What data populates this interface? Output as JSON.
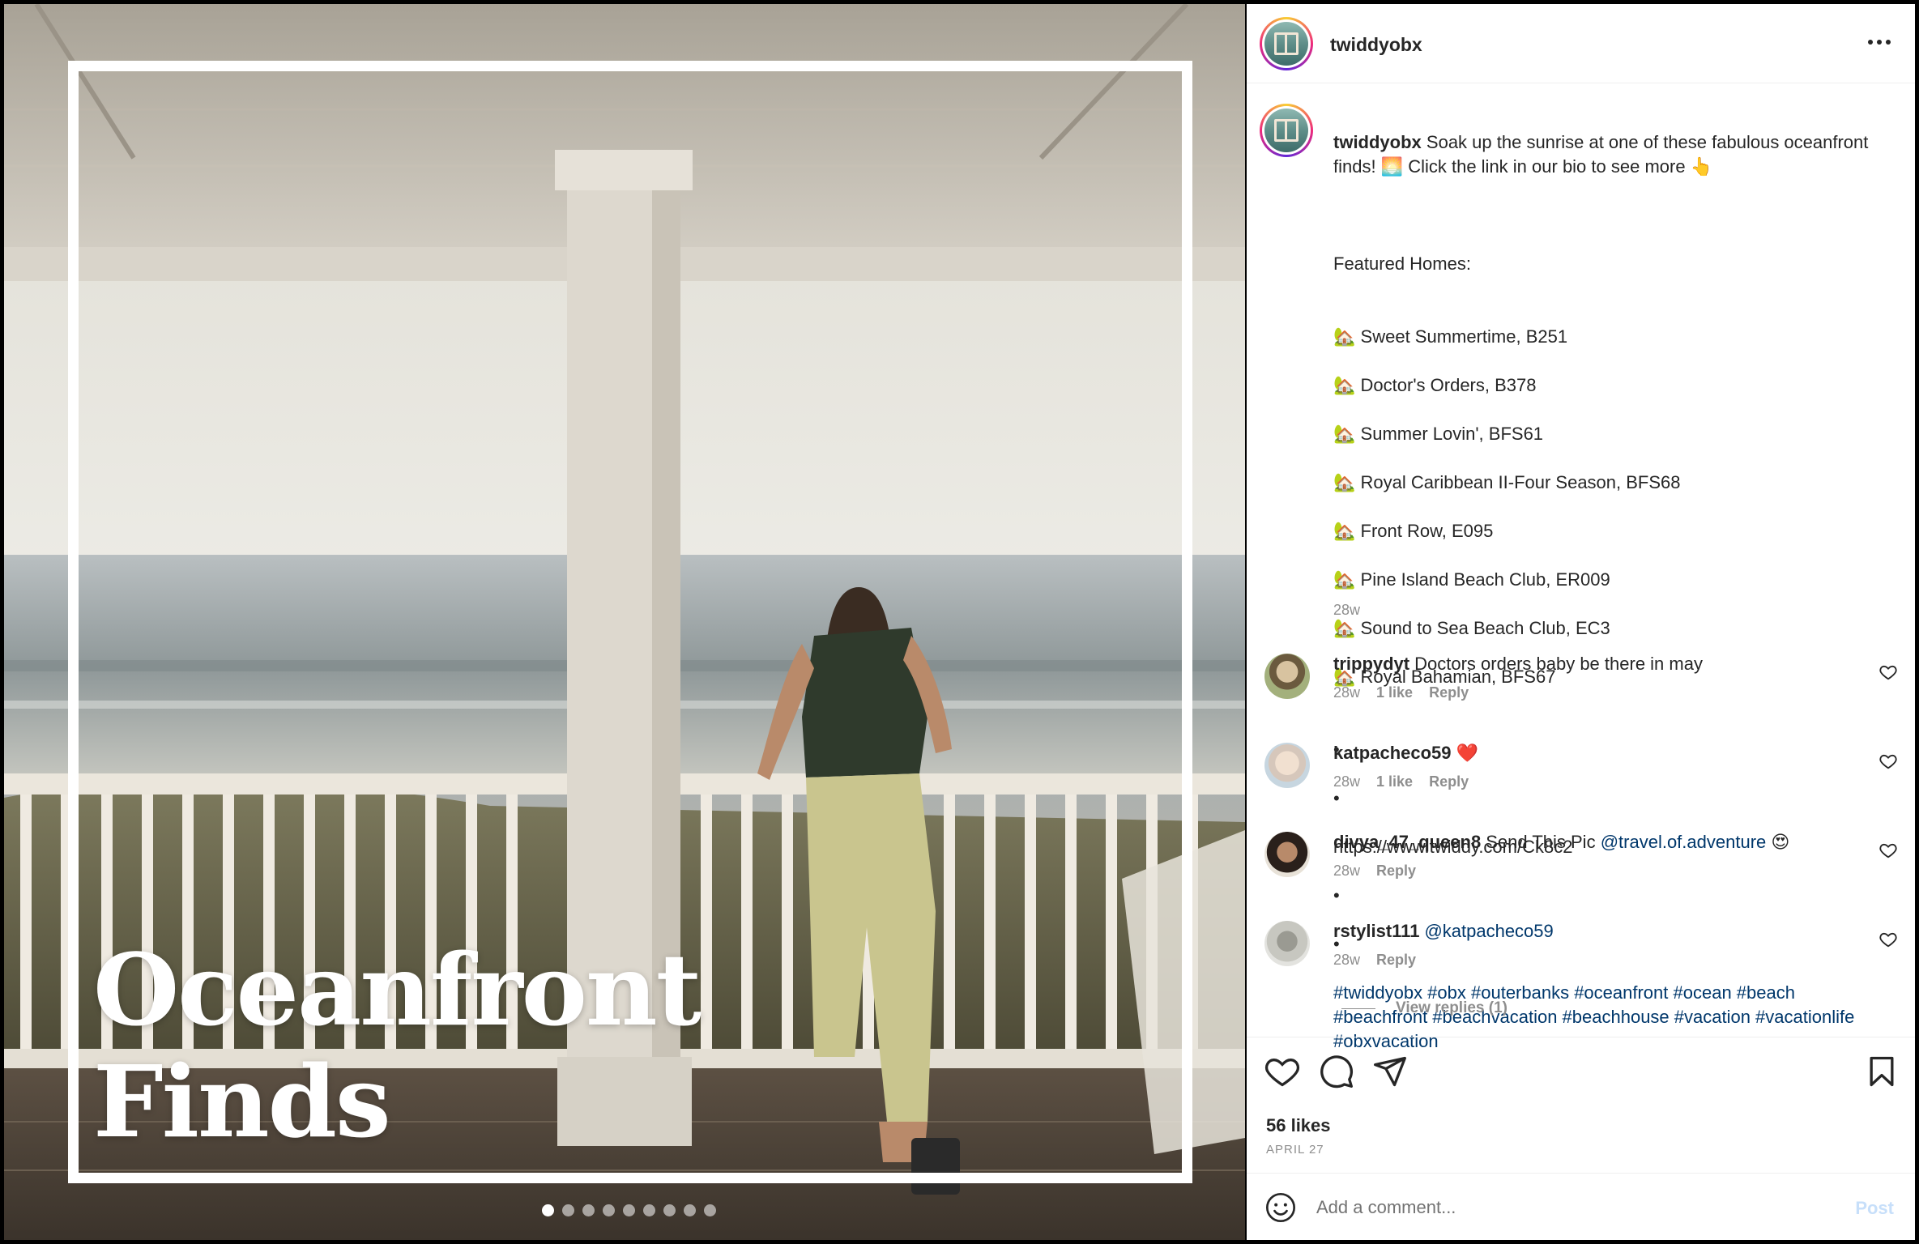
{
  "post": {
    "username": "twiddyobx",
    "media": {
      "headline_line1": "Oceanfront",
      "headline_line2": "Finds",
      "carousel_count": 9,
      "carousel_active_index": 0
    },
    "caption": {
      "username": "twiddyobx",
      "intro": "Soak up the sunrise at one of these fabulous oceanfront finds! 🌅 Click the link in our bio to see more 👆",
      "featured_heading": "Featured Homes:",
      "homes": [
        "Sweet Summertime, B251",
        "Doctor's Orders, B378",
        "Summer Lovin', BFS61",
        "Royal Caribbean II-Four Season, BFS68",
        "Front Row, E095",
        "Pine Island Beach Club, ER009",
        "Sound to Sea Beach Club, EC3",
        "Royal Bahamian, BFS67"
      ],
      "home_icon": "🏡",
      "dot": "•",
      "link": "https://www.twiddy.com/Ck8c2",
      "hashtags": "#twiddyobx #obx #outerbanks #oceanfront #ocean #beach #beachfront #beachvacation #beachhouse #vacation #vacationlife #obxvacation",
      "time": "28w"
    },
    "comments": [
      {
        "username": "trippydyt",
        "text": "Doctors orders baby be there in may",
        "time": "28w",
        "likes": "1 like",
        "reply": "Reply"
      },
      {
        "username": "katpacheco59",
        "text": "❤️",
        "time": "28w",
        "likes": "1 like",
        "reply": "Reply"
      },
      {
        "username": "divya_47_queen8",
        "text": "Send This Pic",
        "mention": "@travel.of.adventure",
        "suffix": "😍",
        "time": "28w",
        "reply": "Reply"
      },
      {
        "username": "rstylist111",
        "mention": "@katpacheco59",
        "time": "28w",
        "reply": "Reply"
      }
    ],
    "view_replies": "View replies (1)",
    "likes_count": "56 likes",
    "date": "APRIL 27",
    "add_comment_placeholder": "Add a comment...",
    "post_button": "Post"
  },
  "icons": [
    "more-icon",
    "heart-icon",
    "comment-icon",
    "share-icon",
    "bookmark-icon",
    "emoji-icon"
  ],
  "colors": {
    "link": "#00376b",
    "muted": "#8e8e8e",
    "post_button_disabled": "#c7dffa",
    "text": "#262626"
  }
}
